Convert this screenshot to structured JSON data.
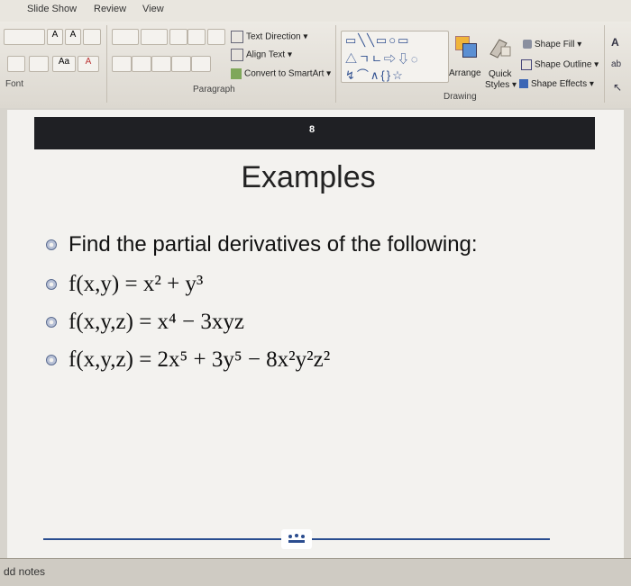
{
  "tabs": {
    "slide_show": "Slide Show",
    "review": "Review",
    "view": "View"
  },
  "ribbon": {
    "font_group": "Font",
    "paragraph_group": "Paragraph",
    "drawing_group": "Drawing",
    "text_direction": "Text Direction",
    "align_text": "Align Text",
    "convert_smartart": "Convert to SmartArt",
    "arrange": "Arrange",
    "quick_styles_1": "Quick",
    "quick_styles_2": "Styles",
    "shape_fill": "Shape Fill",
    "shape_outline": "Shape Outline",
    "shape_effects": "Shape Effects"
  },
  "slide": {
    "number": "8",
    "title": "Examples",
    "intro": "Find the partial derivatives of the following:",
    "equations": [
      "f(x,y) = x² + y³",
      "f(x,y,z) = x⁴ − 3xyz",
      "f(x,y,z) = 2x⁵ + 3y⁵ − 8x²y²z²"
    ]
  },
  "notes": {
    "placeholder": "dd notes"
  }
}
